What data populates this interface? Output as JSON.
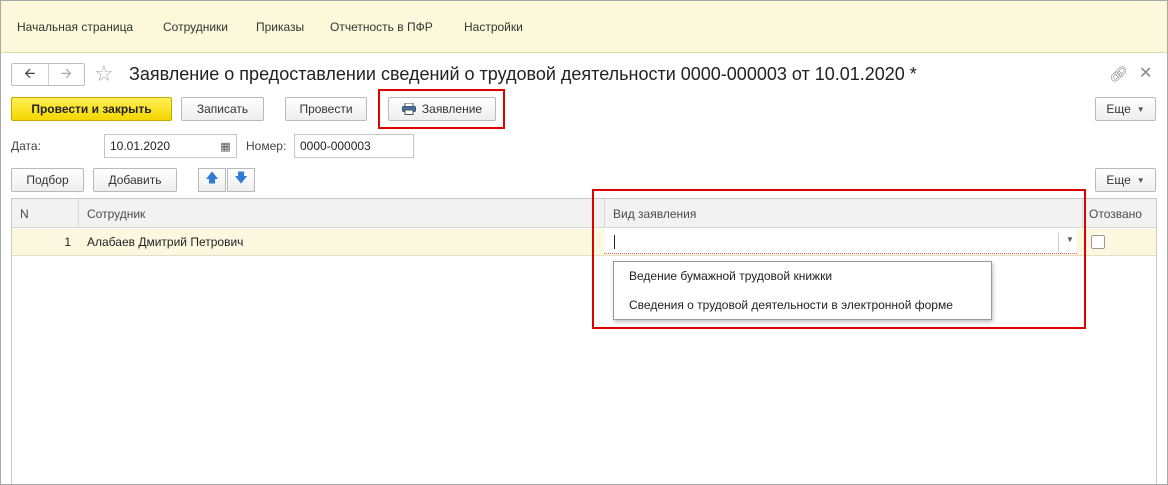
{
  "topnav": {
    "items": [
      "Начальная страница",
      "Сотрудники",
      "Приказы",
      "Отчетность в ПФР",
      "Настройки"
    ]
  },
  "header": {
    "title": "Заявление о предоставлении сведений о трудовой деятельности 0000-000003 от 10.01.2020 *"
  },
  "toolbar": {
    "post_close_label": "Провести и закрыть",
    "save_label": "Записать",
    "post_label": "Провести",
    "statement_label": "Заявление",
    "more_label": "Еще"
  },
  "form": {
    "date_label": "Дата:",
    "date_value": "10.01.2020",
    "number_label": "Номер:",
    "number_value": "0000-000003"
  },
  "table_toolbar": {
    "select_label": "Подбор",
    "add_label": "Добавить",
    "more_label": "Еще"
  },
  "table": {
    "columns": [
      "N",
      "Сотрудник",
      "Вид заявления",
      "Отозвано"
    ],
    "rows": [
      {
        "n": "1",
        "employee": "Алабаев Дмитрий Петрович",
        "type": "",
        "revoked": false
      }
    ]
  },
  "dropdown": {
    "options": [
      "Ведение бумажной трудовой книжки",
      "Сведения о трудовой деятельности в электронной форме"
    ]
  },
  "colors": {
    "highlight_red": "#e00000",
    "primary_yellow": "#f5d600",
    "nav_background": "#fbf9d9",
    "row_selected": "#fcf8e0"
  }
}
